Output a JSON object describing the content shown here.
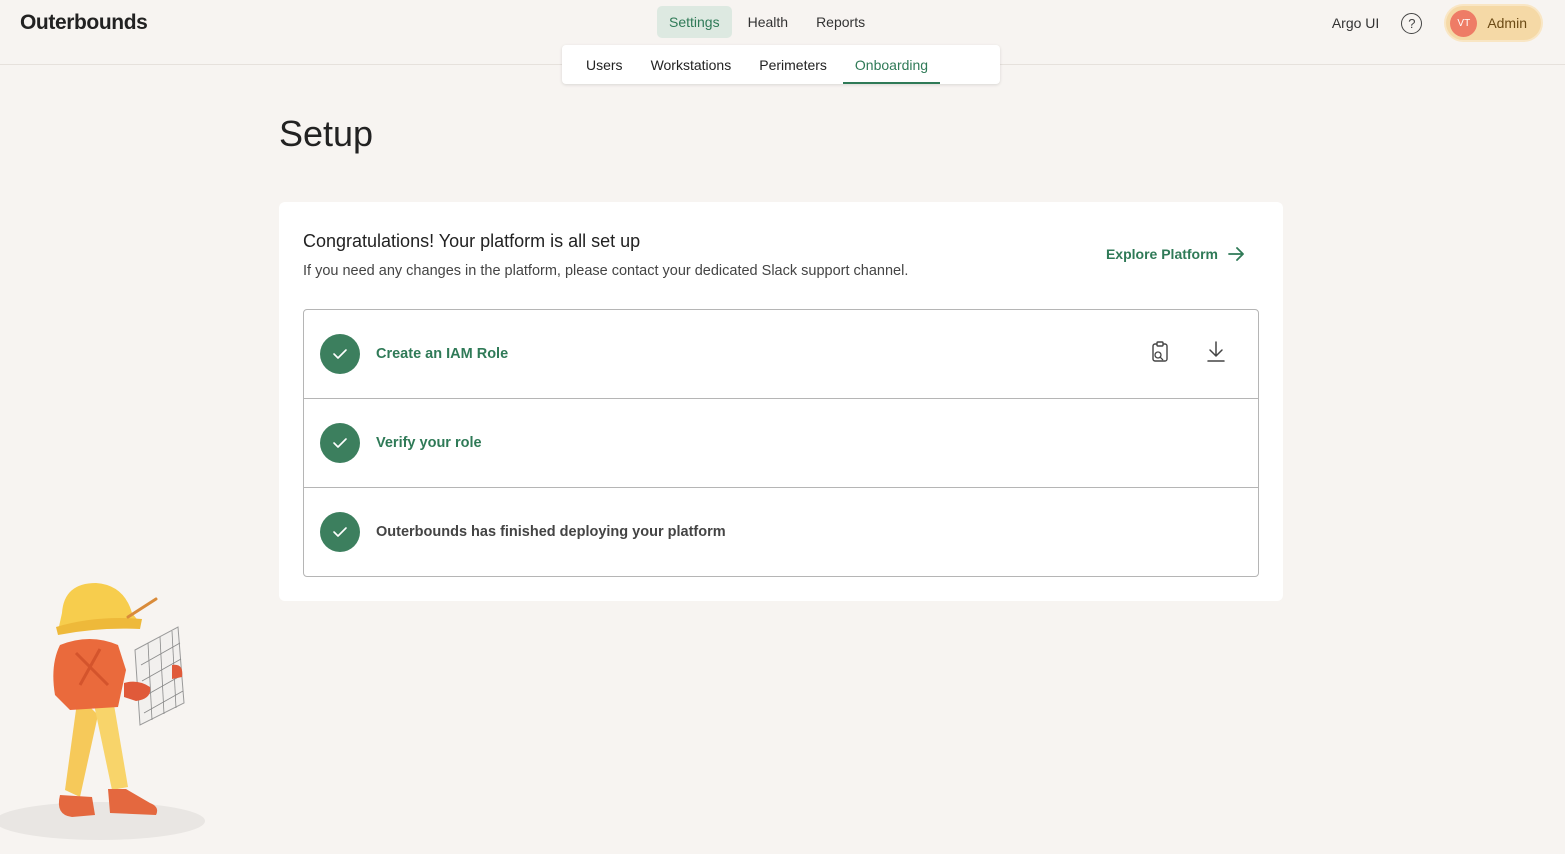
{
  "brand": "Outerbounds",
  "main_nav": [
    {
      "label": "Settings",
      "active": true
    },
    {
      "label": "Health",
      "active": false
    },
    {
      "label": "Reports",
      "active": false
    }
  ],
  "sub_nav": [
    {
      "label": "Users",
      "active": false
    },
    {
      "label": "Workstations",
      "active": false
    },
    {
      "label": "Perimeters",
      "active": false
    },
    {
      "label": "Onboarding",
      "active": true
    }
  ],
  "header_right": {
    "argo_label": "Argo UI",
    "help_icon": "question-circle-icon",
    "user_initials": "VT",
    "user_role": "Admin"
  },
  "page": {
    "title": "Setup"
  },
  "card": {
    "title": "Congratulations! Your platform is all set up",
    "subtitle": "If you need any changes in the platform, please contact your dedicated Slack support channel.",
    "explore_label": "Explore Platform"
  },
  "steps": [
    {
      "label": "Create an IAM Role",
      "status": "complete",
      "actions": [
        "copy-icon",
        "download-icon"
      ]
    },
    {
      "label": "Verify your role",
      "status": "complete"
    },
    {
      "label": "Outerbounds has finished deploying your platform",
      "status": "complete"
    }
  ],
  "colors": {
    "accent": "#2f7a57",
    "check_badge": "#3c7f5e",
    "background": "#f7f4f1",
    "user_pill": "#f5d9a6",
    "avatar": "#ee7c66"
  }
}
